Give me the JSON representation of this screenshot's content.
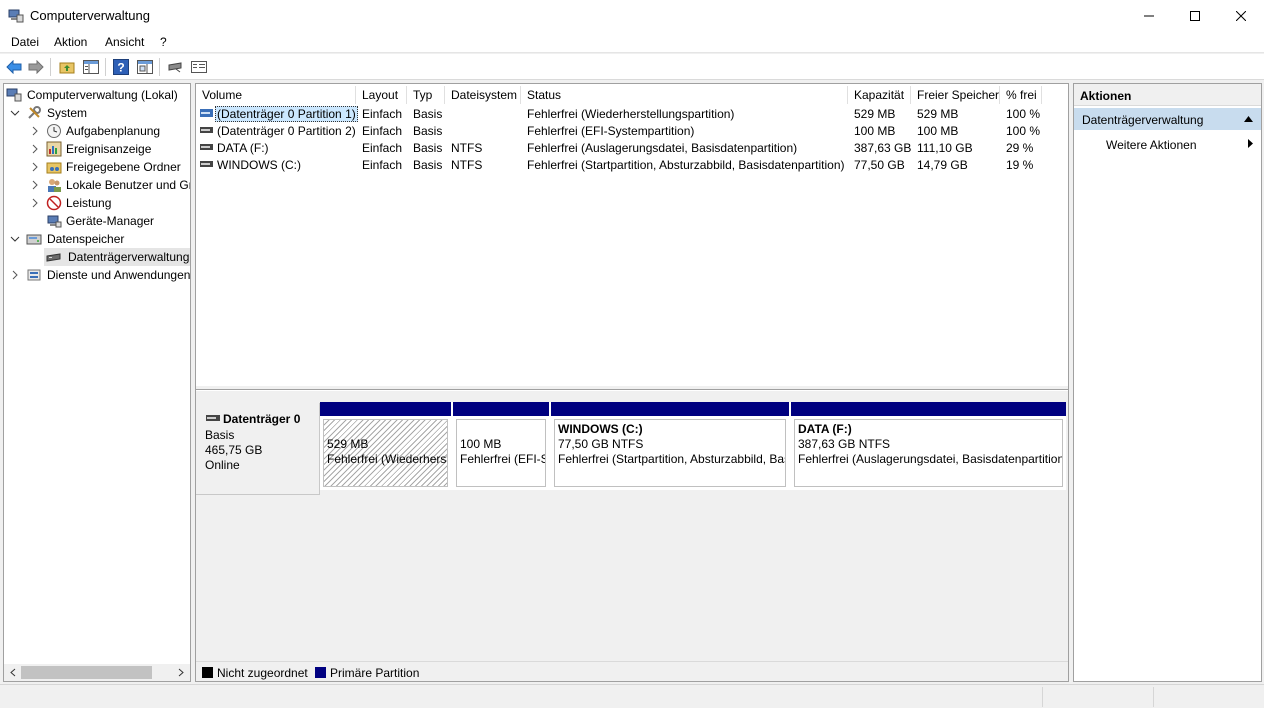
{
  "window": {
    "title": "Computerverwaltung"
  },
  "menu": [
    "Datei",
    "Aktion",
    "Ansicht",
    "?"
  ],
  "toolbar": {
    "icons": [
      "back-arrow-icon",
      "forward-arrow-icon",
      "folder-up-icon",
      "show-hide-tree-icon",
      "help-icon",
      "properties-icon",
      "disk-icon",
      "list-view-icon"
    ]
  },
  "tree": {
    "root": "Computerverwaltung (Lokal)",
    "system": "System",
    "system_children": [
      "Aufgabenplanung",
      "Ereignisanzeige",
      "Freigegebene Ordner",
      "Lokale Benutzer und Gruppen",
      "Leistung",
      "Geräte-Manager"
    ],
    "storage": "Datenspeicher",
    "storage_children": [
      "Datenträgerverwaltung"
    ],
    "services": "Dienste und Anwendungen"
  },
  "volumes": {
    "columns": [
      "Volume",
      "Layout",
      "Typ",
      "Dateisystem",
      "Status",
      "Kapazität",
      "Freier Speicher",
      "% frei"
    ],
    "rows": [
      {
        "volume": "(Datenträger 0 Partition 1)",
        "layout": "Einfach",
        "typ": "Basis",
        "fs": "",
        "status": "Fehlerfrei (Wiederherstellungspartition)",
        "cap": "529 MB",
        "free": "529 MB",
        "pct": "100 %"
      },
      {
        "volume": "(Datenträger 0 Partition 2)",
        "layout": "Einfach",
        "typ": "Basis",
        "fs": "",
        "status": "Fehlerfrei (EFI-Systempartition)",
        "cap": "100 MB",
        "free": "100 MB",
        "pct": "100 %"
      },
      {
        "volume": "DATA (F:)",
        "layout": "Einfach",
        "typ": "Basis",
        "fs": "NTFS",
        "status": "Fehlerfrei (Auslagerungsdatei, Basisdatenpartition)",
        "cap": "387,63 GB",
        "free": "111,10 GB",
        "pct": "29 %"
      },
      {
        "volume": "WINDOWS (C:)",
        "layout": "Einfach",
        "typ": "Basis",
        "fs": "NTFS",
        "status": "Fehlerfrei (Startpartition, Absturzabbild, Basisdatenpartition)",
        "cap": "77,50 GB",
        "free": "14,79 GB",
        "pct": "19 %"
      }
    ]
  },
  "disk": {
    "name": "Datenträger 0",
    "type": "Basis",
    "size": "465,75 GB",
    "state": "Online",
    "partitions": [
      {
        "title": "",
        "size": "529 MB",
        "status": "Fehlerfrei (Wiederherstellungspartition)"
      },
      {
        "title": "",
        "size": "100 MB",
        "status": "Fehlerfrei (EFI-Systempartition)"
      },
      {
        "title": "WINDOWS  (C:)",
        "size": "77,50 GB NTFS",
        "status": "Fehlerfrei (Startpartition, Absturzabbild, Basisdatenpartition)"
      },
      {
        "title": "DATA  (F:)",
        "size": "387,63 GB NTFS",
        "status": "Fehlerfrei (Auslagerungsdatei, Basisdatenpartition)"
      }
    ]
  },
  "legend": [
    {
      "label": "Nicht zugeordnet",
      "color": "#000000"
    },
    {
      "label": "Primäre Partition",
      "color": "#000080"
    }
  ],
  "actions": {
    "header": "Aktionen",
    "group": "Datenträgerverwaltung",
    "items": [
      "Weitere Aktionen"
    ]
  }
}
